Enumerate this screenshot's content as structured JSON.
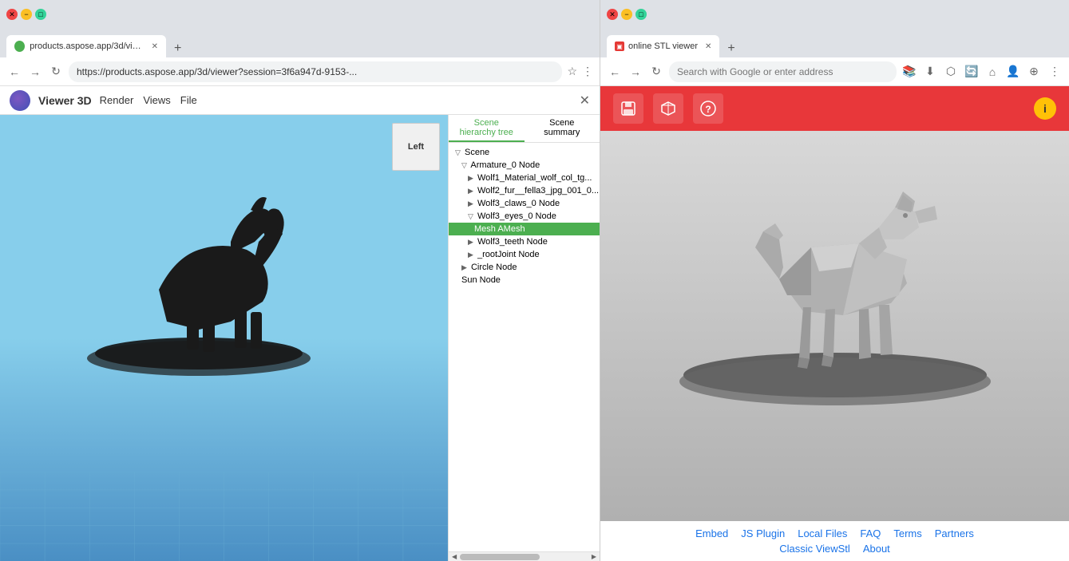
{
  "left_browser": {
    "tab_title": "products.aspose.app/3d/view...",
    "tab_favicon_color": "#4CAF50",
    "address_url": "https://products.aspose.app/3d/viewer?session=3f6a947d-9153-...",
    "app_title": "Viewer 3D",
    "menu_items": [
      "Render",
      "Views",
      "File"
    ],
    "orientation_cube_label": "Left",
    "panel": {
      "tabs": [
        "Scene hierarchy tree",
        "Scene summary"
      ],
      "active_tab": "Scene hierarchy tree",
      "tree_items": [
        {
          "label": "Scene",
          "indent": 1,
          "arrow": "▽",
          "selected": false
        },
        {
          "label": "Armature_0 Node",
          "indent": 2,
          "arrow": "▽",
          "selected": false
        },
        {
          "label": "Wolf1_Material_wolf_col_tg...",
          "indent": 3,
          "arrow": "▶",
          "selected": false
        },
        {
          "label": "Wolf2_fur__fella3_jpg_001_0...",
          "indent": 3,
          "arrow": "▶",
          "selected": false
        },
        {
          "label": "Wolf3_claws_0 Node",
          "indent": 3,
          "arrow": "▶",
          "selected": false
        },
        {
          "label": "Wolf3_eyes_0 Node",
          "indent": 3,
          "arrow": "▽",
          "selected": false
        },
        {
          "label": "Mesh AMesh",
          "indent": 4,
          "arrow": "",
          "selected": true
        },
        {
          "label": "Wolf3_teeth Node",
          "indent": 3,
          "arrow": "▶",
          "selected": false
        },
        {
          "label": "_rootJoint Node",
          "indent": 3,
          "arrow": "▶",
          "selected": false
        },
        {
          "label": "Circle Node",
          "indent": 2,
          "arrow": "▶",
          "selected": false
        },
        {
          "label": "Sun Node",
          "indent": 2,
          "arrow": "",
          "selected": false
        }
      ]
    }
  },
  "right_browser": {
    "tab_title": "online STL viewer",
    "address_placeholder": "Search with Google or enter address",
    "toolbar_buttons": [
      "save-icon",
      "cube-icon",
      "help-icon"
    ],
    "footer_links_row1": [
      "JS Plugin",
      "Local Files",
      "FAQ",
      "Terms",
      "Partners"
    ],
    "footer_links_row2": [
      "Classic ViewStl",
      "About"
    ]
  }
}
